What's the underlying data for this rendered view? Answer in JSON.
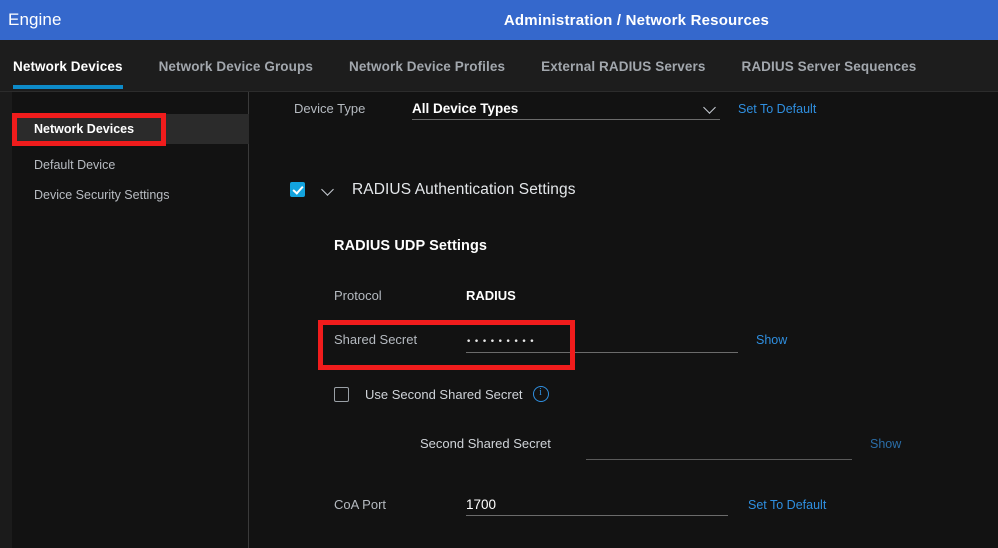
{
  "header": {
    "left_label": "Engine",
    "title": "Administration / Network Resources",
    "bar_color": "#3568cc"
  },
  "tabs": [
    {
      "label": "Network Devices",
      "active": true
    },
    {
      "label": "Network Device Groups",
      "active": false
    },
    {
      "label": "Network Device Profiles",
      "active": false
    },
    {
      "label": "External RADIUS Servers",
      "active": false
    },
    {
      "label": "RADIUS Server Sequences",
      "active": false
    }
  ],
  "tab_accent_color": "#0d8bc9",
  "sidebar": {
    "items": [
      {
        "label": "Network Devices",
        "selected": true
      },
      {
        "label": "Default Device",
        "selected": false
      },
      {
        "label": "Device Security Settings",
        "selected": false
      }
    ]
  },
  "main": {
    "device_type": {
      "label": "Device Type",
      "value": "All Device Types",
      "chevron_icon": "chevron-down-icon",
      "action_label": "Set To Default"
    },
    "radius_auth": {
      "checkbox_state": "checked",
      "chevron_icon": "chevron-down-icon",
      "title": "RADIUS Authentication Settings"
    },
    "udp_settings": {
      "title": "RADIUS UDP Settings",
      "protocol": {
        "label": "Protocol",
        "value": "RADIUS"
      },
      "shared_secret": {
        "label": "Shared Secret",
        "value": "•••••••••",
        "masked": true,
        "action_label": "Show"
      },
      "use_second_shared_secret": {
        "label": "Use Second Shared Secret",
        "checkbox_state": "unchecked",
        "info_icon": "info-icon"
      },
      "second_shared_secret": {
        "label": "Second Shared Secret",
        "value": "",
        "action_label": "Show"
      },
      "coa_port": {
        "label": "CoA Port",
        "value": "1700",
        "action_label": "Set To Default"
      }
    }
  },
  "annotations": {
    "color": "#f01c1c",
    "boxes": [
      {
        "name": "highlight-network-devices"
      },
      {
        "name": "highlight-shared-secret"
      }
    ]
  }
}
